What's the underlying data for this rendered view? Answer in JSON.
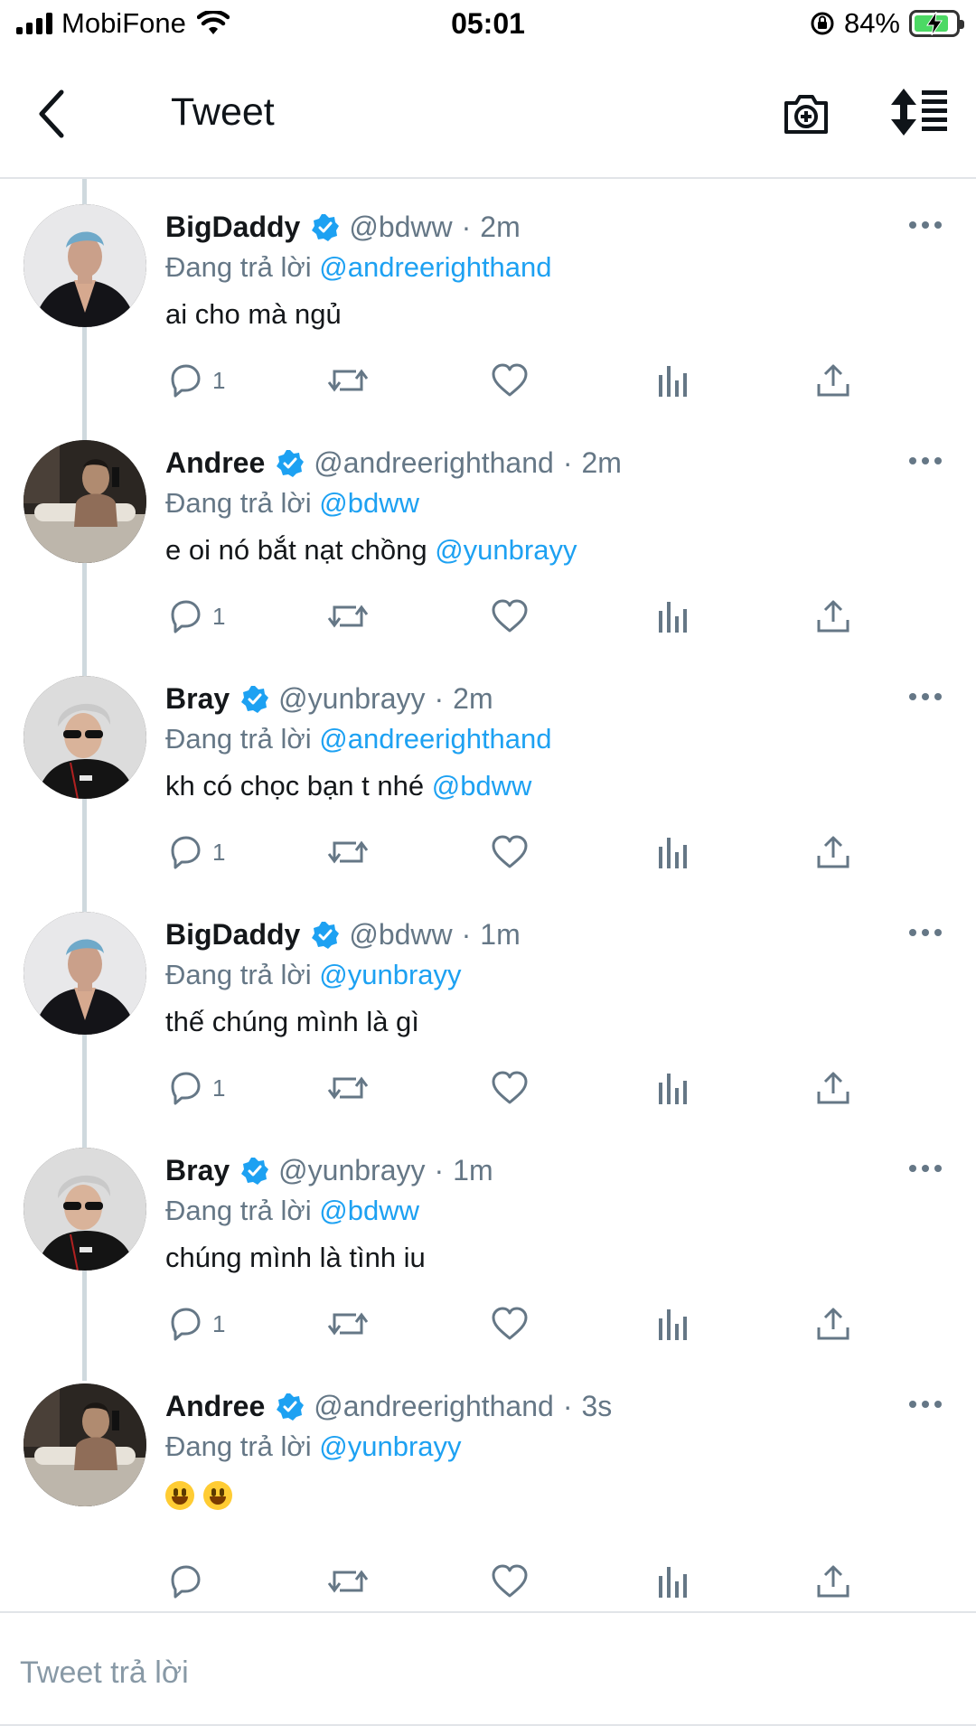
{
  "status_bar": {
    "carrier": "MobiFone",
    "time": "05:01",
    "battery_percent": "84%",
    "battery_level": 0.84
  },
  "header": {
    "title": "Tweet",
    "back_icon": "chevron-left-icon",
    "camera_icon": "camera-add-icon",
    "sort_icon": "sort-icon"
  },
  "colors": {
    "mention": "#1da1f2",
    "muted": "#657786",
    "verified": "#1da1f2",
    "thread_line": "#cfd9de"
  },
  "tweets": [
    {
      "name": "BigDaddy",
      "handle": "@bdww",
      "dot": "·",
      "time": "2m",
      "reply_prefix": "Đang trả lời",
      "reply_to": "@andreerighthand",
      "text": "ai cho mà ngủ",
      "text_mention": "",
      "reply_count": "1"
    },
    {
      "name": "Andree",
      "handle": "@andreerighthand",
      "dot": "·",
      "time": "2m",
      "reply_prefix": "Đang trả lời",
      "reply_to": "@bdww",
      "text": "e oi nó bắt nạt chồng",
      "text_mention": "@yunbrayy",
      "reply_count": "1"
    },
    {
      "name": "Bray",
      "handle": "@yunbrayy",
      "dot": "·",
      "time": "2m",
      "reply_prefix": "Đang trả lời",
      "reply_to": "@andreerighthand",
      "text": "kh có chọc bạn t nhé",
      "text_mention": "@bdww",
      "reply_count": "1"
    },
    {
      "name": "BigDaddy",
      "handle": "@bdww",
      "dot": "·",
      "time": "1m",
      "reply_prefix": "Đang trả lời",
      "reply_to": "@yunbrayy",
      "text": "thế chúng mình là gì",
      "text_mention": "",
      "reply_count": "1"
    },
    {
      "name": "Bray",
      "handle": "@yunbrayy",
      "dot": "·",
      "time": "1m",
      "reply_prefix": "Đang trả lời",
      "reply_to": "@bdww",
      "text": "chúng mình là tình iu",
      "text_mention": "",
      "reply_count": "1"
    },
    {
      "name": "Andree",
      "handle": "@andreerighthand",
      "dot": "·",
      "time": "3s",
      "reply_prefix": "Đang trả lời",
      "reply_to": "@yunbrayy",
      "text": "",
      "text_mention": "",
      "reply_count": "",
      "emojis": [
        "grinning-face-emoji",
        "grinning-face-emoji"
      ]
    }
  ],
  "composer": {
    "placeholder": "Tweet trả lời",
    "value": ""
  }
}
